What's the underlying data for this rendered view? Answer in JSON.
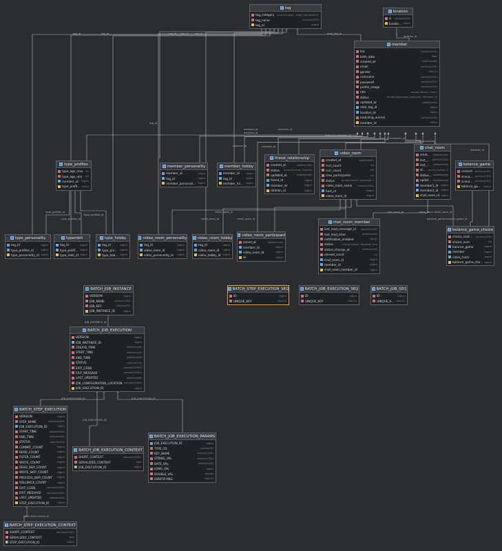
{
  "tables": {
    "tag": {
      "name": "tag",
      "columns": [
        {
          "name": "tag_category",
          "type": "enum('hobby','mbti','personality','t",
          "kind": "c"
        },
        {
          "name": "tag_name",
          "type": "varchar(255)",
          "kind": "c"
        },
        {
          "name": "tag_id",
          "type": "bigint",
          "kind": "pk"
        }
      ]
    },
    "location": {
      "name": "location",
      "columns": [
        {
          "name": "si",
          "type": "varchar(255)",
          "kind": "c"
        },
        {
          "name": "location_id",
          "type": "bigint",
          "kind": "pk"
        }
      ]
    },
    "member": {
      "name": "member",
      "columns": [
        {
          "name": "bio",
          "type": "varchar(255)",
          "kind": "c"
        },
        {
          "name": "birth_date",
          "type": "date",
          "kind": "c"
        },
        {
          "name": "created_at",
          "type": "datetime(6)",
          "kind": "c"
        },
        {
          "name": "email",
          "type": "varchar(255)",
          "kind": "c"
        },
        {
          "name": "gender",
          "type": "char(1)",
          "kind": "c"
        },
        {
          "name": "nickname",
          "type": "varchar(255)",
          "kind": "c"
        },
        {
          "name": "password",
          "type": "varchar(255)",
          "kind": "c"
        },
        {
          "name": "profile_image",
          "type": "varchar(255)",
          "kind": "c"
        },
        {
          "name": "role",
          "type": "enum('admin','user')",
          "kind": "c"
        },
        {
          "name": "status",
          "type": "enum('approved','pending','rejected','withdrawn')",
          "kind": "c"
        },
        {
          "name": "updated_at",
          "type": "datetime(6)",
          "kind": "c"
        },
        {
          "name": "mbti_tag_id",
          "type": "bigint",
          "kind": "fk"
        },
        {
          "name": "location_id",
          "type": "bigint",
          "kind": "fk"
        },
        {
          "name": "matching_animal",
          "type": "varchar(255)",
          "kind": "c"
        },
        {
          "name": "member_id",
          "type": "bigint",
          "kind": "pk"
        }
      ]
    },
    "video_room": {
      "name": "video_room",
      "columns": [
        {
          "name": "created_at",
          "type": "datetime(6)",
          "kind": "c"
        },
        {
          "name": "curr_count",
          "type": "int",
          "kind": "c"
        },
        {
          "name": "curr_count",
          "type": "int",
          "kind": "c"
        },
        {
          "name": "max_participants",
          "type": "int",
          "kind": "c"
        },
        {
          "name": "status",
          "type": "enum('active','personal','ready')",
          "kind": "c"
        },
        {
          "name": "video_room_name",
          "type": "varchar(255)",
          "kind": "c"
        },
        {
          "name": "host_id",
          "type": "bigint",
          "kind": "fk"
        },
        {
          "name": "video_room_id",
          "type": "bigint",
          "kind": "pk"
        }
      ]
    },
    "chat_room": {
      "name": "chat_room",
      "columns": [
        {
          "name": "created_at",
          "type": "datetime(6)",
          "kind": "c"
        },
        {
          "name": "last_message",
          "type": "varchar(255)",
          "kind": "c"
        },
        {
          "name": "last_message_time",
          "type": "datetime(6)",
          "kind": "c"
        },
        {
          "name": "status",
          "type": "enum('active','inactive')",
          "kind": "c"
        },
        {
          "name": "status_changed_at",
          "type": "datetime(6)",
          "kind": "c"
        },
        {
          "name": "updated_at",
          "type": "datetime(6)",
          "kind": "c"
        },
        {
          "name": "member1_id",
          "type": "bigint",
          "kind": "fk"
        },
        {
          "name": "member2_id",
          "type": "bigint",
          "kind": "fk"
        },
        {
          "name": "chat_room_id",
          "type": "bigint",
          "kind": "pk"
        }
      ]
    },
    "type_profiles": {
      "name": "type_profiles",
      "columns": [
        {
          "name": "type_age_max",
          "type": "int",
          "kind": "c"
        },
        {
          "name": "type_age_min",
          "type": "int",
          "kind": "c"
        },
        {
          "name": "member_id",
          "type": "bigint",
          "kind": "fk"
        },
        {
          "name": "type_profiles_id",
          "type": "bigint",
          "kind": "pk"
        }
      ]
    },
    "member_personality": {
      "name": "member_personality",
      "columns": [
        {
          "name": "member_id",
          "type": "bigint",
          "kind": "fk"
        },
        {
          "name": "tag_id",
          "type": "bigint",
          "kind": "fk"
        },
        {
          "name": "member_personality_id",
          "type": "bigint",
          "kind": "pk"
        }
      ]
    },
    "member_hobby": {
      "name": "member_hobby",
      "columns": [
        {
          "name": "member_id",
          "type": "bigint",
          "kind": "fk"
        },
        {
          "name": "tag_id",
          "type": "bigint",
          "kind": "fk"
        },
        {
          "name": "member_hobby_id",
          "type": "bigint",
          "kind": "pk"
        }
      ]
    },
    "friend_relationship": {
      "name": "friend_relationship",
      "columns": [
        {
          "name": "created_at",
          "type": "datetime(6)",
          "kind": "c"
        },
        {
          "name": "status",
          "type": "enum('active','inactive')",
          "kind": "c"
        },
        {
          "name": "updated_at",
          "type": "datetime(6)",
          "kind": "c"
        },
        {
          "name": "friend_id",
          "type": "bigint",
          "kind": "fk"
        },
        {
          "name": "member_id",
          "type": "bigint",
          "kind": "fk"
        },
        {
          "name": "relation_id",
          "type": "bigint",
          "kind": "pk"
        }
      ]
    },
    "balance_game": {
      "name": "balance_game",
      "columns": [
        {
          "name": "content",
          "type": "varchar(255)",
          "kind": "c"
        },
        {
          "name": "scenario1",
          "type": "varchar(255)",
          "kind": "c"
        },
        {
          "name": "scenario2",
          "type": "varchar(255)",
          "kind": "c"
        },
        {
          "name": "balance_game_id",
          "type": "bigint",
          "kind": "pk"
        }
      ]
    },
    "chat_room_member": {
      "name": "chat_room_member",
      "columns": [
        {
          "name": "last_read_message_id",
          "type": "varchar(255)",
          "kind": "c"
        },
        {
          "name": "last_read_time",
          "type": "datetime(6)",
          "kind": "c"
        },
        {
          "name": "notification_enabled",
          "type": "bit(1)",
          "kind": "c"
        },
        {
          "name": "status",
          "type": "enum('active','blocked','inactive')",
          "kind": "c"
        },
        {
          "name": "status_change_at",
          "type": "datetime(6)",
          "kind": "c"
        },
        {
          "name": "unread_count",
          "type": "int",
          "kind": "c"
        },
        {
          "name": "chat_room_id",
          "type": "bigint",
          "kind": "fk"
        },
        {
          "name": "member_id",
          "type": "bigint",
          "kind": "fk"
        },
        {
          "name": "chat_room_member_id",
          "type": "bigint",
          "kind": "pk"
        }
      ]
    },
    "balance_game_choice": {
      "name": "balance_game_choice",
      "columns": [
        {
          "name": "choice_content",
          "type": "varchar(255)",
          "kind": "c"
        },
        {
          "name": "choice_num",
          "type": "int",
          "kind": "c"
        },
        {
          "name": "balance_game",
          "type": "bigint",
          "kind": "fk"
        },
        {
          "name": "member",
          "type": "bigint",
          "kind": "fk"
        },
        {
          "name": "video_room",
          "type": "bigint",
          "kind": "fk"
        },
        {
          "name": "balance_game_choice_id",
          "type": "bigint",
          "kind": "pk"
        }
      ]
    },
    "type_personality": {
      "name": "type_personality",
      "columns": [
        {
          "name": "tag_id",
          "type": "bigint",
          "kind": "fk"
        },
        {
          "name": "type_profiles_id",
          "type": "bigint",
          "kind": "fk"
        },
        {
          "name": "type_personality_id",
          "type": "bigint",
          "kind": "pk"
        }
      ]
    },
    "typembti": {
      "name": "typembti",
      "columns": [
        {
          "name": "tag_id",
          "type": "bigint",
          "kind": "fk"
        },
        {
          "name": "type_profiles_id",
          "type": "bigint",
          "kind": "fk"
        },
        {
          "name": "type_mbti_id",
          "type": "bigint",
          "kind": "pk"
        }
      ]
    },
    "type_hobby": {
      "name": "type_hobby",
      "columns": [
        {
          "name": "tag_id",
          "type": "bigint",
          "kind": "fk"
        },
        {
          "name": "type_profiles_id",
          "type": "bigint",
          "kind": "fk"
        },
        {
          "name": "type_hobby_id",
          "type": "bigint",
          "kind": "pk"
        }
      ]
    },
    "video_room_personality": {
      "name": "video_room_personality",
      "columns": [
        {
          "name": "tag_id",
          "type": "bigint",
          "kind": "fk"
        },
        {
          "name": "video_room_id",
          "type": "bigint",
          "kind": "fk"
        },
        {
          "name": "video_personality_id",
          "type": "bigint",
          "kind": "pk"
        }
      ]
    },
    "video_room_hobby": {
      "name": "video_room_hobby",
      "columns": [
        {
          "name": "tag_id",
          "type": "bigint",
          "kind": "fk"
        },
        {
          "name": "video_room_id",
          "type": "bigint",
          "kind": "fk"
        },
        {
          "name": "video_hobby_id",
          "type": "bigint",
          "kind": "pk"
        }
      ]
    },
    "video_room_participant": {
      "name": "video_room_participant",
      "columns": [
        {
          "name": "joined_at",
          "type": "datetime(6)",
          "kind": "c"
        },
        {
          "name": "member_id",
          "type": "bigint",
          "kind": "fk"
        },
        {
          "name": "video_room_id",
          "type": "bigint",
          "kind": "fk"
        },
        {
          "name": "id",
          "type": "bigint",
          "kind": "pk"
        }
      ]
    },
    "batch_job_instance": {
      "name": "BATCH_JOB_INSTANCE",
      "columns": [
        {
          "name": "VERSION",
          "type": "bigint",
          "kind": "c"
        },
        {
          "name": "JOB_NAME",
          "type": "varchar(100)",
          "kind": "c"
        },
        {
          "name": "JOB_KEY",
          "type": "varchar(32)",
          "kind": "c"
        },
        {
          "name": "JOB_INSTANCE_ID",
          "type": "bigint",
          "kind": "pk"
        }
      ]
    },
    "batch_step_execution_seq": {
      "name": "BATCH_STEP_EXECUTION_SEQ",
      "columns": [
        {
          "name": "ID",
          "type": "bigint",
          "kind": "c"
        },
        {
          "name": "UNIQUE_KEY",
          "type": "char(1)",
          "kind": "c"
        }
      ]
    },
    "batch_job_execution_seq": {
      "name": "BATCH_JOB_EXECUTION_SEQ",
      "columns": [
        {
          "name": "ID",
          "type": "bigint",
          "kind": "c"
        },
        {
          "name": "UNIQUE_KEY",
          "type": "char(1)",
          "kind": "c"
        }
      ]
    },
    "batch_job_seq": {
      "name": "BATCH_JOB_SEQ",
      "columns": [
        {
          "name": "ID",
          "type": "bigint",
          "kind": "c"
        },
        {
          "name": "UNIQUE_KEY",
          "type": "char(1)",
          "kind": "c"
        }
      ]
    },
    "batch_job_execution": {
      "name": "BATCH_JOB_EXECUTION",
      "columns": [
        {
          "name": "VERSION",
          "type": "bigint",
          "kind": "c"
        },
        {
          "name": "JOB_INSTANCE_ID",
          "type": "bigint",
          "kind": "fk"
        },
        {
          "name": "CREATE_TIME",
          "type": "datetime(6)",
          "kind": "c"
        },
        {
          "name": "START_TIME",
          "type": "datetime(6)",
          "kind": "c"
        },
        {
          "name": "END_TIME",
          "type": "datetime(6)",
          "kind": "c"
        },
        {
          "name": "STATUS",
          "type": "varchar(10)",
          "kind": "c"
        },
        {
          "name": "EXIT_CODE",
          "type": "varchar(2500)",
          "kind": "c"
        },
        {
          "name": "EXIT_MESSAGE",
          "type": "varchar(2500)",
          "kind": "c"
        },
        {
          "name": "LAST_UPDATED",
          "type": "datetime(6)",
          "kind": "c"
        },
        {
          "name": "JOB_CONFIGURATION_LOCATION",
          "type": "varchar(2500)",
          "kind": "c"
        },
        {
          "name": "JOB_EXECUTION_ID",
          "type": "bigint",
          "kind": "pk"
        }
      ]
    },
    "batch_step_execution": {
      "name": "BATCH_STEP_EXECUTION",
      "columns": [
        {
          "name": "VERSION",
          "type": "bigint",
          "kind": "c"
        },
        {
          "name": "STEP_NAME",
          "type": "varchar(100)",
          "kind": "c"
        },
        {
          "name": "JOB_EXECUTION_ID",
          "type": "bigint",
          "kind": "fk"
        },
        {
          "name": "START_TIME",
          "type": "datetime(6)",
          "kind": "c"
        },
        {
          "name": "END_TIME",
          "type": "datetime(6)",
          "kind": "c"
        },
        {
          "name": "STATUS",
          "type": "varchar(10)",
          "kind": "c"
        },
        {
          "name": "COMMIT_COUNT",
          "type": "bigint",
          "kind": "c"
        },
        {
          "name": "READ_COUNT",
          "type": "bigint",
          "kind": "c"
        },
        {
          "name": "FILTER_COUNT",
          "type": "bigint",
          "kind": "c"
        },
        {
          "name": "WRITE_COUNT",
          "type": "bigint",
          "kind": "c"
        },
        {
          "name": "READ_SKIP_COUNT",
          "type": "bigint",
          "kind": "c"
        },
        {
          "name": "WRITE_SKIP_COUNT",
          "type": "bigint",
          "kind": "c"
        },
        {
          "name": "PROCESS_SKIP_COUNT",
          "type": "bigint",
          "kind": "c"
        },
        {
          "name": "ROLLBACK_COUNT",
          "type": "bigint",
          "kind": "c"
        },
        {
          "name": "EXIT_CODE",
          "type": "varchar(2500)",
          "kind": "c"
        },
        {
          "name": "EXIT_MESSAGE",
          "type": "varchar(2500)",
          "kind": "c"
        },
        {
          "name": "LAST_UPDATED",
          "type": "datetime(6)",
          "kind": "c"
        },
        {
          "name": "STEP_EXECUTION_ID",
          "type": "bigint",
          "kind": "pk"
        }
      ]
    },
    "batch_job_execution_context": {
      "name": "BATCH_JOB_EXECUTION_CONTEXT",
      "columns": [
        {
          "name": "SHORT_CONTEXT",
          "type": "varchar(2500)",
          "kind": "c"
        },
        {
          "name": "SERIALIZED_CONTEXT",
          "type": "text",
          "kind": "c"
        },
        {
          "name": "JOB_EXECUTION_ID",
          "type": "bigint",
          "kind": "pf"
        }
      ]
    },
    "batch_job_execution_params": {
      "name": "BATCH_JOB_EXECUTION_PARAMS",
      "columns": [
        {
          "name": "JOB_EXECUTION_ID",
          "type": "bigint",
          "kind": "fk"
        },
        {
          "name": "TYPE_CD",
          "type": "varchar(6)",
          "kind": "c"
        },
        {
          "name": "KEY_NAME",
          "type": "varchar(100)",
          "kind": "c"
        },
        {
          "name": "STRING_VAL",
          "type": "varchar(250)",
          "kind": "c"
        },
        {
          "name": "DATE_VAL",
          "type": "datetime(6)",
          "kind": "c"
        },
        {
          "name": "LONG_VAL",
          "type": "bigint",
          "kind": "c"
        },
        {
          "name": "DOUBLE_VAL",
          "type": "double",
          "kind": "c"
        },
        {
          "name": "IDENTIFYING",
          "type": "char(1)",
          "kind": "c"
        }
      ]
    },
    "batch_step_execution_context": {
      "name": "BATCH_STEP_EXECUTION_CONTEXT",
      "columns": [
        {
          "name": "SHORT_CONTEXT",
          "type": "varchar(2500)",
          "kind": "c"
        },
        {
          "name": "SERIALIZED_CONTEXT",
          "type": "text",
          "kind": "c"
        },
        {
          "name": "STEP_EXECUTION_ID",
          "type": "bigint",
          "kind": "pf"
        }
      ]
    }
  },
  "link_labels": {
    "tag_id": "tag_id",
    "location_id": "location_id",
    "mbti_tag_id": "mbti_tag_id",
    "member_id": "member_id",
    "friend_id": "friend_id",
    "host_id": "host_id",
    "member1_id": "member1_id",
    "member2_id": "member2_id",
    "friend_id_member_id": "friend_id member_id",
    "type_profiles_id": "type_profiles_id",
    "video_room_id": "video_room_id",
    "chat_room_id": "chat_room_id",
    "balance_game_balance_game_id": "balance_game balance_game_id",
    "video_room_video_room_id": "video_room video_room_id",
    "balance_game": "balance_game",
    "job_instance_id": "JOB_INSTANCE_ID",
    "job_execution_id": "JOB_EXECUTION_ID",
    "step_execution_id": "STEP_EXECUTION_ID"
  },
  "colors": {
    "background": "#2b2d30",
    "table": "#1f2124",
    "header": "#393c41",
    "border": "#5f6369",
    "selected_border": "#e8a13c",
    "line": "#b9bcc1",
    "pk": "#e6c14a",
    "fk": "#69a8e0",
    "column": "#c5787c"
  },
  "icons": {
    "table": "table-icon",
    "column": "column-icon",
    "primary_key": "key-icon",
    "foreign_key": "foreign-key-icon"
  }
}
